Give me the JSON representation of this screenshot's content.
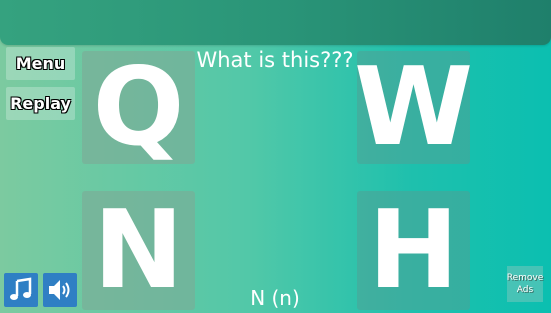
{
  "nav": {
    "menu_label": "Menu",
    "replay_label": "Replay"
  },
  "prompt": {
    "question": "What is this???",
    "answer": "N (n)"
  },
  "tiles": [
    "Q",
    "W",
    "N",
    "H"
  ],
  "ads": {
    "remove_label": "Remove Ads"
  },
  "icons": {
    "music": "music-note-icon",
    "sound": "speaker-icon"
  },
  "colors": {
    "icon_button": "#2f7fc4",
    "top_bar": "#2a9578",
    "background_left": "#7ccaa0",
    "background_right": "#0bbfb0"
  }
}
